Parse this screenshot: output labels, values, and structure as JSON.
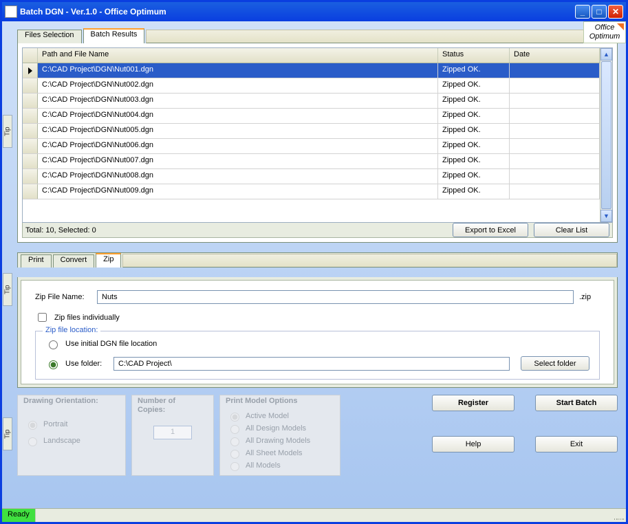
{
  "window": {
    "title": "Batch DGN - Ver.1.0 - Office Optimum"
  },
  "logo": {
    "line1": "Office",
    "line2": "Optimum"
  },
  "tips": [
    "Tip",
    "Tip",
    "Tip"
  ],
  "tabs_top": {
    "files_selection": "Files Selection",
    "batch_results": "Batch Results"
  },
  "grid": {
    "cols": {
      "path": "Path and File Name",
      "status": "Status",
      "date": "Date"
    },
    "rows": [
      {
        "path": "C:\\CAD Project\\DGN\\Nut001.dgn",
        "status": "Zipped OK.",
        "date": ""
      },
      {
        "path": "C:\\CAD Project\\DGN\\Nut002.dgn",
        "status": "Zipped OK.",
        "date": ""
      },
      {
        "path": "C:\\CAD Project\\DGN\\Nut003.dgn",
        "status": "Zipped OK.",
        "date": ""
      },
      {
        "path": "C:\\CAD Project\\DGN\\Nut004.dgn",
        "status": "Zipped OK.",
        "date": ""
      },
      {
        "path": "C:\\CAD Project\\DGN\\Nut005.dgn",
        "status": "Zipped OK.",
        "date": ""
      },
      {
        "path": "C:\\CAD Project\\DGN\\Nut006.dgn",
        "status": "Zipped OK.",
        "date": ""
      },
      {
        "path": "C:\\CAD Project\\DGN\\Nut007.dgn",
        "status": "Zipped OK.",
        "date": ""
      },
      {
        "path": "C:\\CAD Project\\DGN\\Nut008.dgn",
        "status": "Zipped OK.",
        "date": ""
      },
      {
        "path": "C:\\CAD Project\\DGN\\Nut009.dgn",
        "status": "Zipped OK.",
        "date": ""
      }
    ],
    "footer": "Total: 10, Selected: 0",
    "btn_export": "Export to Excel",
    "btn_clear": "Clear List"
  },
  "subtabs": {
    "print": "Print",
    "convert": "Convert",
    "zip": "Zip"
  },
  "zip": {
    "label_filename": "Zip File Name:",
    "filename_value": "Nuts",
    "ext": ".zip",
    "cb_individually": "Zip files individually",
    "fieldset": "Zip file location:",
    "opt_initial": "Use initial DGN file location",
    "opt_folder": "Use folder:",
    "folder_value": "C:\\CAD Project\\",
    "btn_select": "Select folder"
  },
  "groups": {
    "orientation": {
      "title": "Drawing Orientation:",
      "portrait": "Portrait",
      "landscape": "Landscape"
    },
    "copies": {
      "title": "Number of Copies:",
      "value": "1"
    },
    "printmodel": {
      "title": "Print Model Options",
      "opts": [
        "Active Model",
        "All Design Models",
        "All Drawing Models",
        "All Sheet Models",
        "All Models"
      ]
    }
  },
  "buttons": {
    "register": "Register",
    "start": "Start Batch",
    "help": "Help",
    "exit": "Exit"
  },
  "status": {
    "ready": "Ready"
  }
}
